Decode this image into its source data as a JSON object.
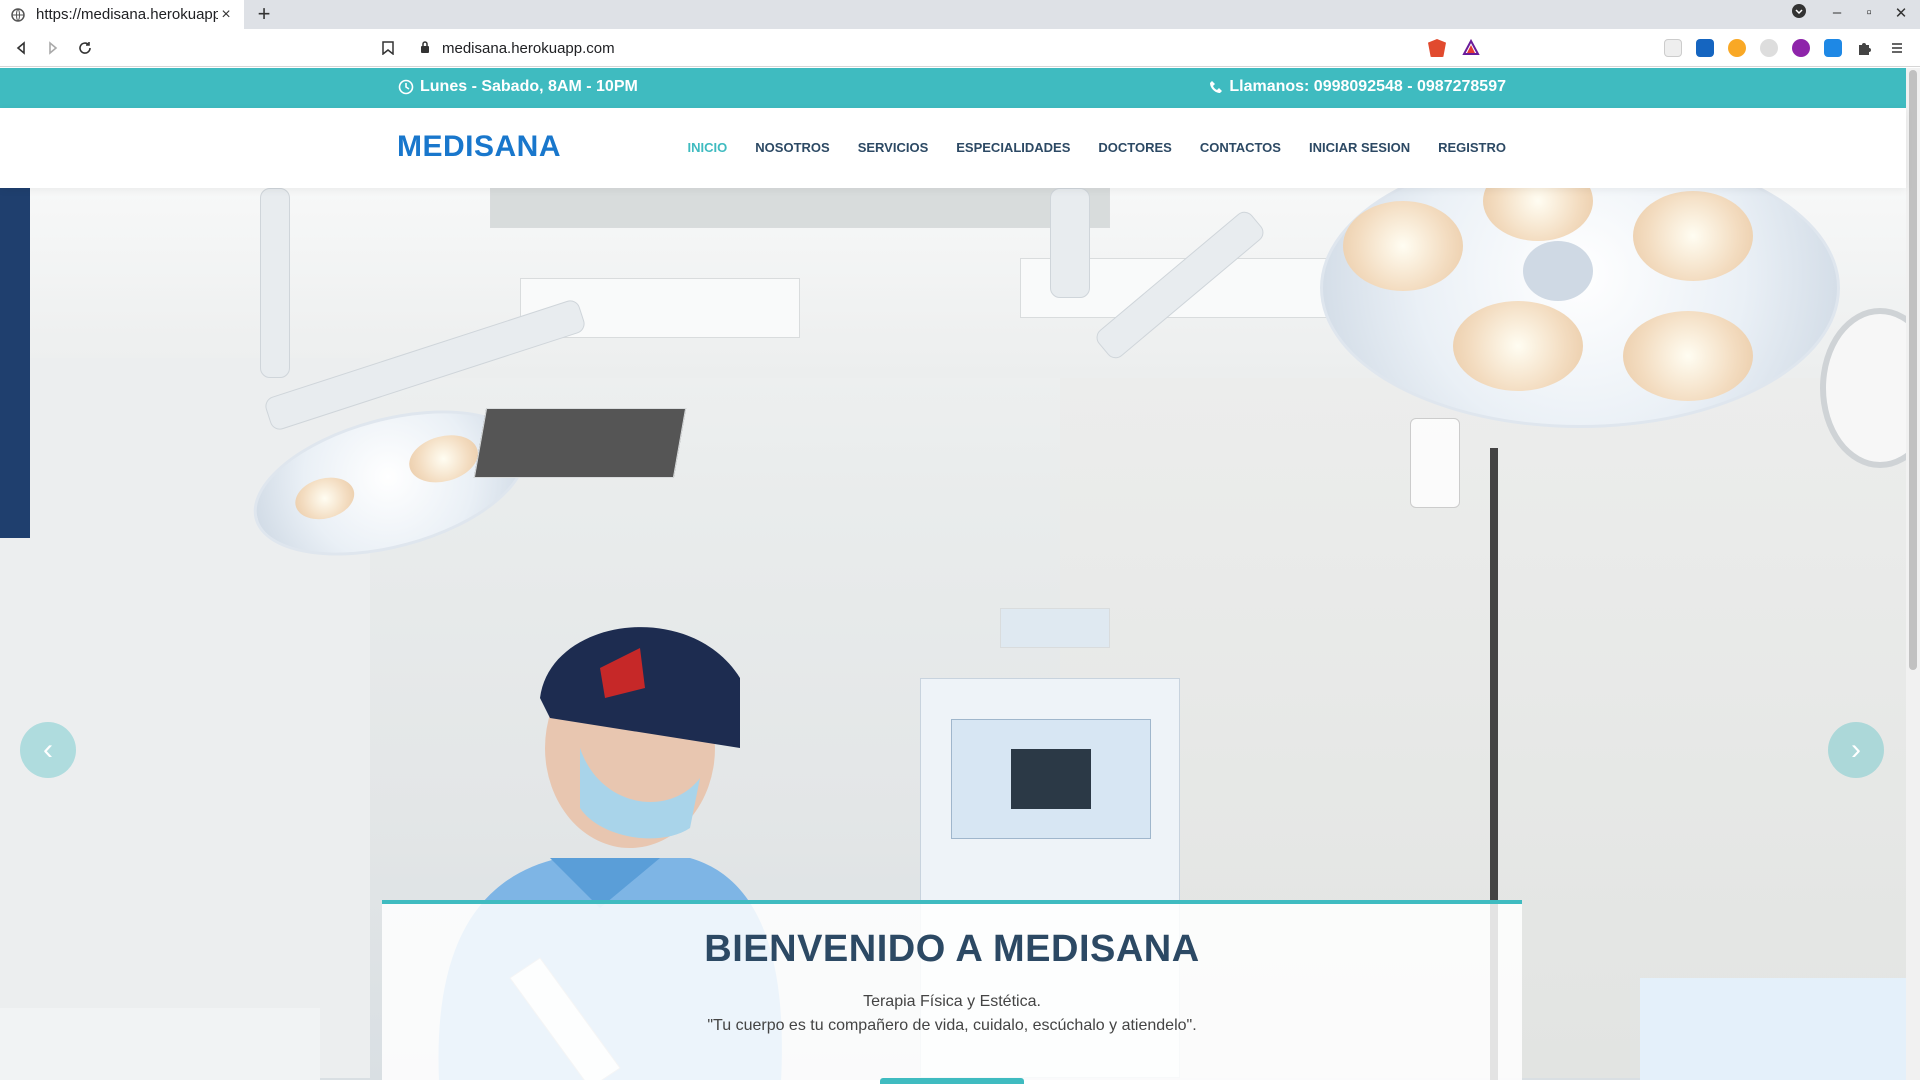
{
  "browser": {
    "tab_title": "https://medisana.herokuapp",
    "tab_close": "×",
    "new_tab": "+",
    "url": "medisana.herokuapp.com"
  },
  "topbar": {
    "hours": "Lunes - Sabado, 8AM - 10PM",
    "phone": "Llamanos: 0998092548 - 0987278597"
  },
  "header": {
    "logo": "MEDISANA",
    "menu": [
      {
        "label": "INICIO",
        "active": true
      },
      {
        "label": "NOSOTROS"
      },
      {
        "label": "SERVICIOS"
      },
      {
        "label": "ESPECIALIDADES"
      },
      {
        "label": "DOCTORES"
      },
      {
        "label": "CONTACTOS"
      },
      {
        "label": "INICIAR SESION"
      },
      {
        "label": "REGISTRO"
      }
    ]
  },
  "hero": {
    "title": "BIENVENIDO A MEDISANA",
    "subtitle": "Terapia Física y Estética.",
    "quote": "\"Tu cuerpo es tu compañero de vida, cuidalo, escúchalo y atiendelo\".",
    "prev": "‹",
    "next": "›"
  },
  "colors": {
    "accent": "#3fbbc0",
    "brand": "#1977cc",
    "nav_text": "#2c4964"
  }
}
